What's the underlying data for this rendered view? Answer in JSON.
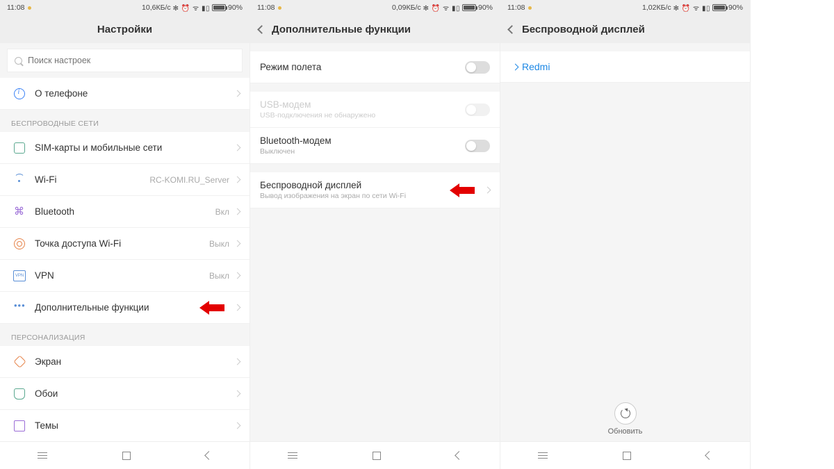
{
  "status": {
    "time": "11:08",
    "battery": "90%"
  },
  "screen1": {
    "speed": "10,6КБ/с",
    "title": "Настройки",
    "search_placeholder": "Поиск настроек",
    "about": "О телефоне",
    "section_wireless": "БЕСПРОВОДНЫЕ СЕТИ",
    "sim": "SIM-карты и мобильные сети",
    "wifi": "Wi-Fi",
    "wifi_value": "RC-KOMI.RU_Server",
    "bt": "Bluetooth",
    "bt_value": "Вкл",
    "hotspot": "Точка доступа Wi-Fi",
    "hotspot_value": "Выкл",
    "vpn": "VPN",
    "vpn_value": "Выкл",
    "more": "Дополнительные функции",
    "section_personal": "ПЕРСОНАЛИЗАЦИЯ",
    "screen": "Экран",
    "wallpaper": "Обои",
    "themes": "Темы"
  },
  "screen2": {
    "speed": "0,09КБ/с",
    "title": "Дополнительные функции",
    "airplane": "Режим полета",
    "usb": "USB-модем",
    "usb_sub": "USB-подключения не обнаружено",
    "btm": "Bluetooth-модем",
    "btm_sub": "Выключен",
    "wdisplay": "Беспроводной дисплей",
    "wdisplay_sub": "Вывод изображения на экран по сети Wi-Fi"
  },
  "screen3": {
    "speed": "1,02КБ/с",
    "title": "Беспроводной дисплей",
    "device": "Redmi",
    "refresh": "Обновить"
  }
}
